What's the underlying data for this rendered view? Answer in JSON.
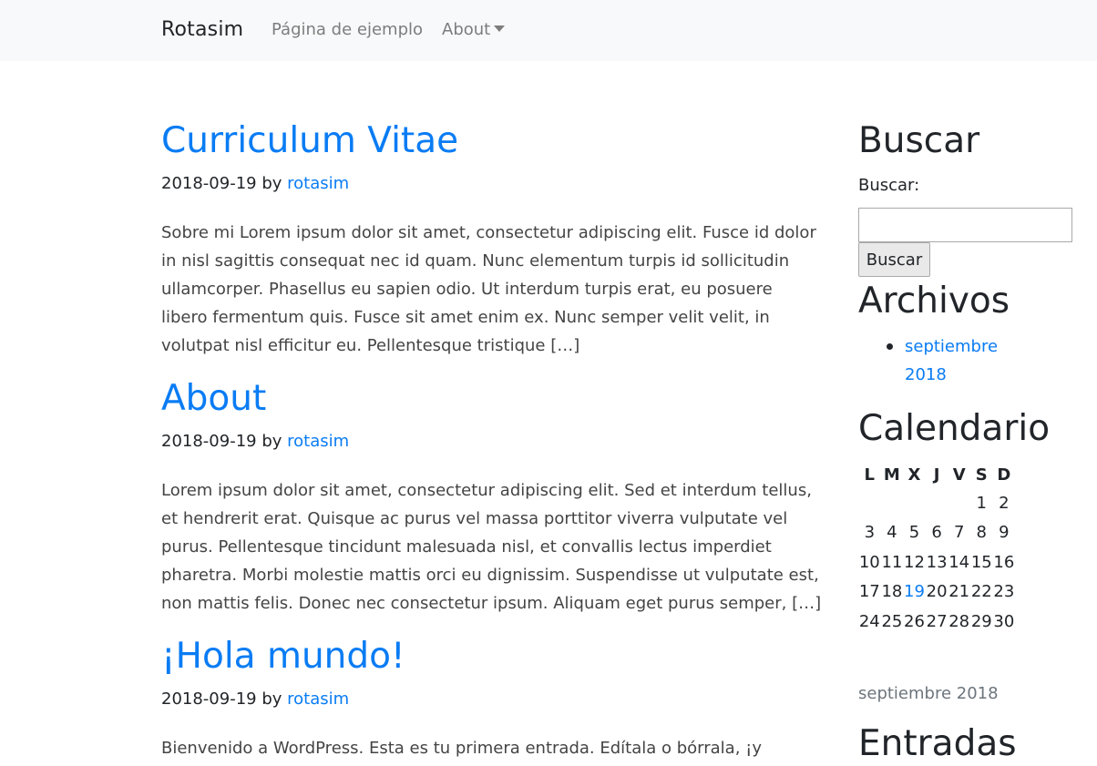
{
  "navbar": {
    "brand": "Rotasim",
    "links": [
      {
        "label": "Página de ejemplo"
      },
      {
        "label": "About",
        "icon": "caret-down-icon"
      }
    ]
  },
  "posts": [
    {
      "title": "Curriculum Vitae",
      "date": "2018-09-19",
      "by": "by",
      "author": "rotasim",
      "excerpt": "Sobre mi Lorem ipsum dolor sit amet, consectetur adipiscing elit. Fusce id dolor in nisl sagittis consequat nec id quam. Nunc elementum turpis id sollicitudin ullamcorper. Phasellus eu sapien odio. Ut interdum turpis erat, eu posuere libero fermentum quis. Fusce sit amet enim ex. Nunc semper velit velit, in volutpat nisl efficitur eu. Pellentesque tristique […]"
    },
    {
      "title": "About",
      "date": "2018-09-19",
      "by": "by",
      "author": "rotasim",
      "excerpt": "Lorem ipsum dolor sit amet, consectetur adipiscing elit. Sed et interdum tellus, et hendrerit erat. Quisque ac purus vel massa porttitor viverra vulputate vel purus. Pellentesque tincidunt malesuada nisl, et convallis lectus imperdiet pharetra. Morbi molestie mattis orci eu dignissim. Suspendisse ut vulputate est, non mattis felis. Donec nec consectetur ipsum. Aliquam eget purus semper, […]"
    },
    {
      "title": "¡Hola mundo!",
      "date": "2018-09-19",
      "by": "by",
      "author": "rotasim",
      "excerpt": "Bienvenido a WordPress. Esta es tu primera entrada. Edítala o bórrala, ¡y"
    }
  ],
  "sidebar": {
    "search": {
      "title": "Buscar",
      "label": "Buscar:",
      "input_value": "",
      "button": "Buscar"
    },
    "archives": {
      "title": "Archivos",
      "items": [
        "septiembre 2018"
      ]
    },
    "calendar": {
      "title": "Calendario",
      "headers": [
        "L",
        "M",
        "X",
        "J",
        "V",
        "S",
        "D"
      ],
      "rows": [
        [
          "",
          "",
          "",
          "",
          "",
          "1",
          "2"
        ],
        [
          "3",
          "4",
          "5",
          "6",
          "7",
          "8",
          "9"
        ],
        [
          "10",
          "11",
          "12",
          "13",
          "14",
          "15",
          "16"
        ],
        [
          "17",
          "18",
          "19",
          "20",
          "21",
          "22",
          "23"
        ],
        [
          "24",
          "25",
          "26",
          "27",
          "28",
          "29",
          "30"
        ]
      ],
      "linked_day": "19",
      "caption": "septiembre 2018"
    },
    "recent": {
      "title": "Entradas"
    }
  }
}
